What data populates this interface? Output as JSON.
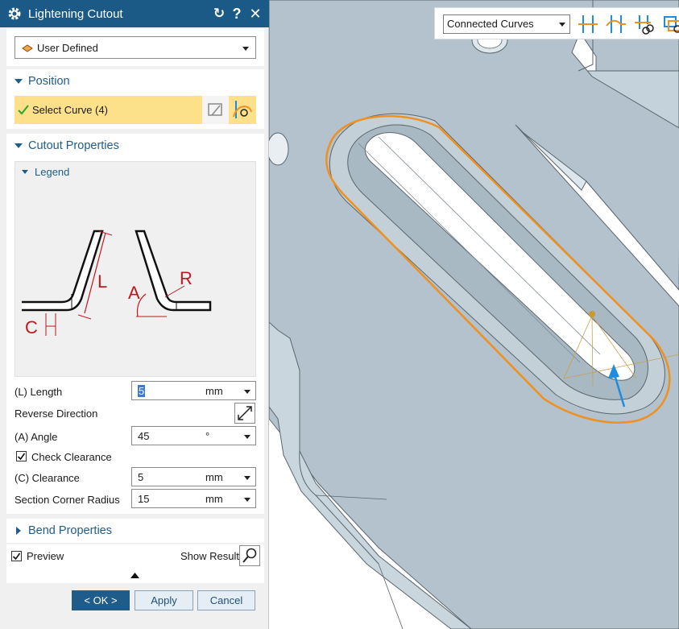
{
  "dialog": {
    "title": "Lightening Cutout",
    "type_selected": "User Defined",
    "position": {
      "header": "Position",
      "select_curve_label": "Select Curve (4)"
    },
    "cutout_properties": {
      "header": "Cutout Properties",
      "legend_header": "Legend",
      "legend_labels": {
        "length": "L",
        "angle": "A",
        "radius": "R",
        "clearance": "C"
      },
      "length": {
        "label": "(L) Length",
        "value": "5",
        "unit": "mm"
      },
      "reverse_direction": {
        "label": "Reverse Direction"
      },
      "angle": {
        "label": "(A) Angle",
        "value": "45",
        "unit": "°"
      },
      "check_clearance": {
        "label": "Check Clearance",
        "checked": true
      },
      "clearance": {
        "label": "(C) Clearance",
        "value": "5",
        "unit": "mm"
      },
      "section_corner_radius": {
        "label": "Section Corner Radius",
        "value": "15",
        "unit": "mm"
      }
    },
    "bend_properties": {
      "header": "Bend Properties"
    },
    "preview": {
      "label": "Preview",
      "checked": true,
      "show_result_label": "Show Result"
    },
    "buttons": {
      "ok": "< OK >",
      "apply": "Apply",
      "cancel": "Cancel"
    }
  },
  "viewport_toolbar": {
    "curve_rule_selected": "Connected Curves"
  },
  "colors": {
    "titlebar": "#1b5a86",
    "section_text": "#1f5c8a",
    "selection_highlight": "#fde08a",
    "part_surface": "#b3c2cc",
    "curve_highlight": "#f0901e",
    "vector_arrow": "#1e8de0"
  },
  "icons": [
    "gear-icon",
    "reset-icon",
    "help-icon",
    "close-icon",
    "flange-icon",
    "checkmark-icon",
    "curve-selection-icon",
    "reverse-direction-icon",
    "magnifier-icon",
    "collapse-arrow-icon"
  ]
}
